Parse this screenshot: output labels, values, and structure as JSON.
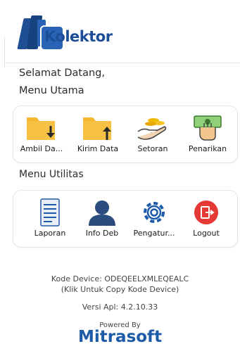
{
  "app": {
    "logo_text": "Kolektor"
  },
  "greeting": {
    "line1": "Selamat Datang,",
    "line2": "Menu Utama"
  },
  "main_menu": [
    {
      "label": "Ambil Da...",
      "icon": "folder-download-icon"
    },
    {
      "label": "Kirim Data",
      "icon": "folder-upload-icon"
    },
    {
      "label": "Setoran",
      "icon": "hand-coins-icon"
    },
    {
      "label": "Penarikan",
      "icon": "money-withdraw-icon"
    }
  ],
  "utility_section": {
    "title": "Menu Utilitas"
  },
  "utility_menu": [
    {
      "label": "Laporan",
      "icon": "document-icon"
    },
    {
      "label": "Info Deb",
      "icon": "person-icon"
    },
    {
      "label": "Pengatur...",
      "icon": "gear-icon"
    },
    {
      "label": "Logout",
      "icon": "logout-icon"
    }
  ],
  "footer": {
    "device_code": "Kode Device: ODEQEELXMLEQEALC",
    "copy_hint": "(Klik Untuk Copy Kode Device)",
    "version": "Versi Apl: 4.2.10.33",
    "powered_by": "Powered By",
    "brand": "Mitrasoft"
  },
  "colors": {
    "primary": "#1d5aa8",
    "folder": "#f5b731",
    "logout_red": "#e53935"
  }
}
